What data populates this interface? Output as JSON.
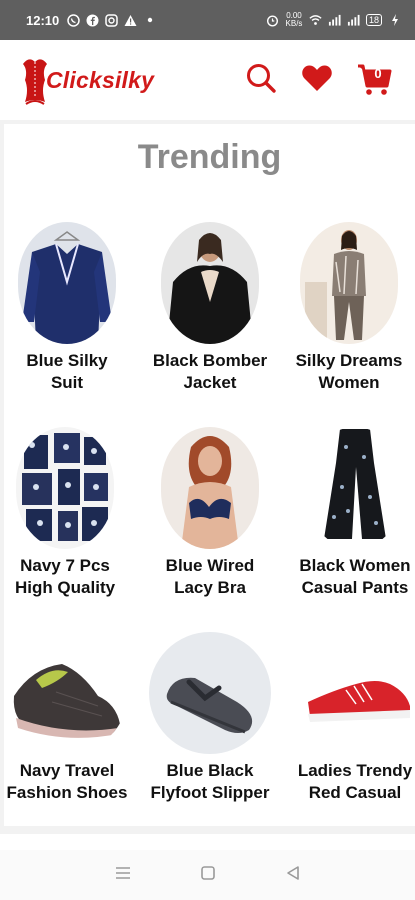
{
  "status": {
    "time": "12:10",
    "net_speed": "0.00\nKB/s",
    "battery": "18"
  },
  "brand": {
    "name": "Clicksilky"
  },
  "header": {
    "cart_count": "0"
  },
  "section": {
    "title": "Trending"
  },
  "products": [
    {
      "line1": "Blue Silky",
      "line2": "Suit"
    },
    {
      "line1": "Black Bomber",
      "line2": "Jacket"
    },
    {
      "line1": "Silky Dreams",
      "line2": "Women"
    },
    {
      "line1": "Navy 7 Pcs",
      "line2": "High Quality"
    },
    {
      "line1": "Blue Wired",
      "line2": "Lacy Bra"
    },
    {
      "line1": "Black Women",
      "line2": "Casual Pants"
    },
    {
      "line1": "Navy Travel",
      "line2": "Fashion Shoes"
    },
    {
      "line1": "Blue Black",
      "line2": "Flyfoot Slipper"
    },
    {
      "line1": "Ladies Trendy",
      "line2": "Red Casual"
    }
  ],
  "colors": {
    "brand_red": "#d11a1a",
    "title_grey": "#8a8a8a",
    "status_bar": "#5f5f5f"
  },
  "icons": {
    "search": "search-icon",
    "wishlist": "heart-icon",
    "cart": "cart-icon"
  }
}
